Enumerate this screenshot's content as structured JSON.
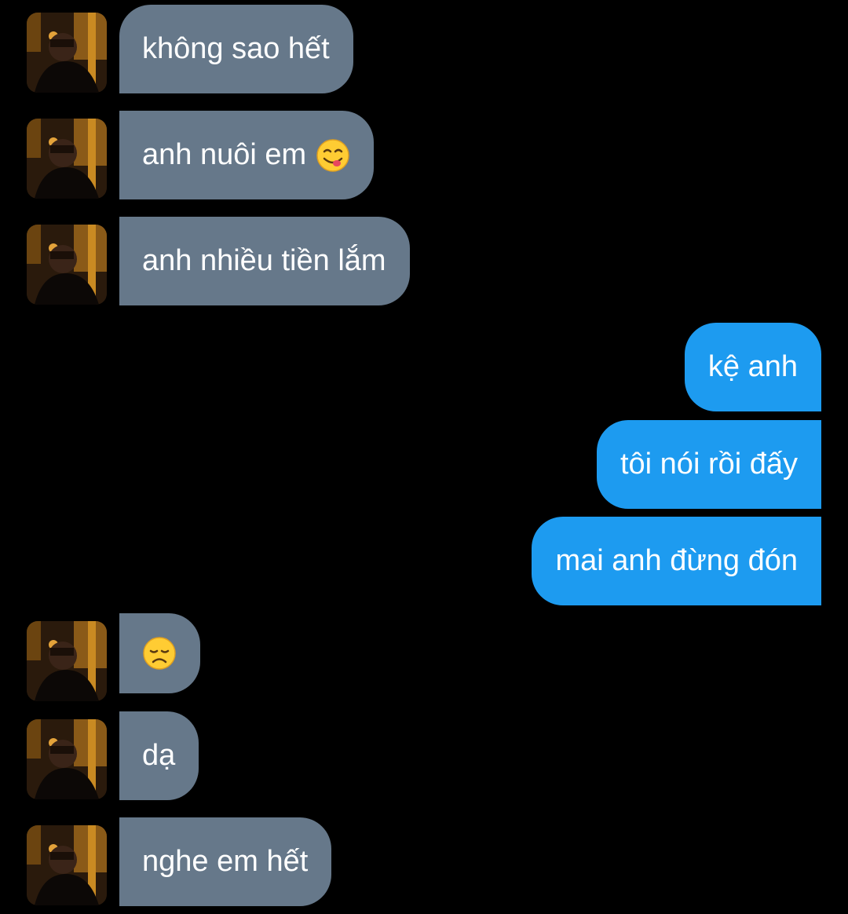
{
  "conversation": {
    "incoming_1": {
      "text": "không sao hết"
    },
    "incoming_2": {
      "text": "anh nuôi em",
      "emoji": "yum-face-emoji"
    },
    "incoming_3": {
      "text": "anh nhiều tiền lắm"
    },
    "outgoing_1": {
      "text": "kệ anh"
    },
    "outgoing_2": {
      "text": "tôi nói rồi đấy"
    },
    "outgoing_3": {
      "text": "mai anh đừng đón"
    },
    "incoming_4": {
      "emoji": "disappointed-face-emoji"
    },
    "incoming_5": {
      "text": "dạ"
    },
    "incoming_6": {
      "text": "nghe em hết"
    }
  },
  "colors": {
    "background": "#000000",
    "incoming_bubble": "#66788a",
    "outgoing_bubble": "#1d9bf0",
    "text": "#ffffff"
  }
}
